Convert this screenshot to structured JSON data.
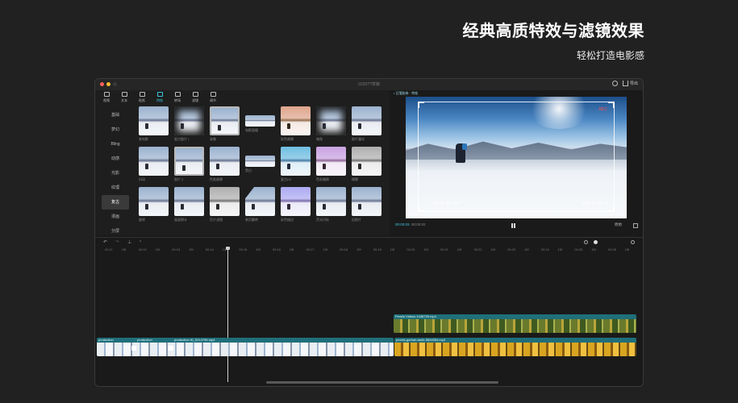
{
  "headline": {
    "title": "经典高质特效与滤镜效果",
    "subtitle": "轻松打造电影感"
  },
  "window": {
    "title": "0320??草稿"
  },
  "titlebar": {
    "export_label": "导出"
  },
  "toolbar": [
    {
      "label": "视频",
      "icon": "video-icon"
    },
    {
      "label": "文本",
      "icon": "text-icon"
    },
    {
      "label": "贴纸",
      "icon": "sticker-icon"
    },
    {
      "label": "特效",
      "icon": "effects-icon",
      "active": true
    },
    {
      "label": "转场",
      "icon": "transition-icon"
    },
    {
      "label": "滤镜",
      "icon": "filter-icon"
    },
    {
      "label": "调节",
      "icon": "adjust-icon"
    }
  ],
  "categories": [
    "基础",
    "梦幻",
    "Bling",
    "动感",
    "光影",
    "纹理",
    "复古",
    "漫画",
    "分屏"
  ],
  "active_category": "复古",
  "effects": [
    "老电影",
    "复古胶片 I",
    "录像",
    "电影画幅",
    "彩色故障",
    "暗角",
    "胶片漏光",
    "抖动",
    "胶片 2",
    "色差故障",
    "黑白",
    "复古DV",
    "色彩偏移",
    "模糊",
    "旋转",
    "画面倒计",
    "负片滤镜",
    "卷页翻转",
    "彩色描边",
    "荧光闪烁",
    "旧照片"
  ],
  "preview": {
    "label": "• 日落胶卷 · 特效",
    "rec_time": "00:15 : 04 : 20",
    "rec_meta": "1080  4K 25 : 9",
    "rec_indicator": "REC",
    "current_time": "00:00:03",
    "total_time": "00:00:02",
    "ratio_label": "原始"
  },
  "timeline": {
    "ruler": [
      "00:11",
      "15f",
      "00:12",
      "15f",
      "00:13",
      "15f",
      "00:14",
      "15f",
      "00:15",
      "15f",
      "00:16",
      "15f",
      "00:17",
      "15f",
      "00:18",
      "15f",
      "00:19",
      "15f",
      "00:20",
      "15f",
      "00:21",
      "15f",
      "00:22",
      "15f",
      "00:23",
      "15f",
      "00:24",
      "15f",
      "00:25",
      "15f",
      "00:26",
      "15f"
    ],
    "overlay_clip": "Pexels Videos 1448735.mp4",
    "main_clips": [
      "production",
      "production",
      "production ID_5214796.mp4"
    ],
    "main_clip_b": "pexels-gorhan-taulh-5844554.mp4"
  },
  "colors": {
    "accent": "#3ec7e0",
    "window_bg": "#1a1a1a",
    "page_bg": "#212121"
  }
}
